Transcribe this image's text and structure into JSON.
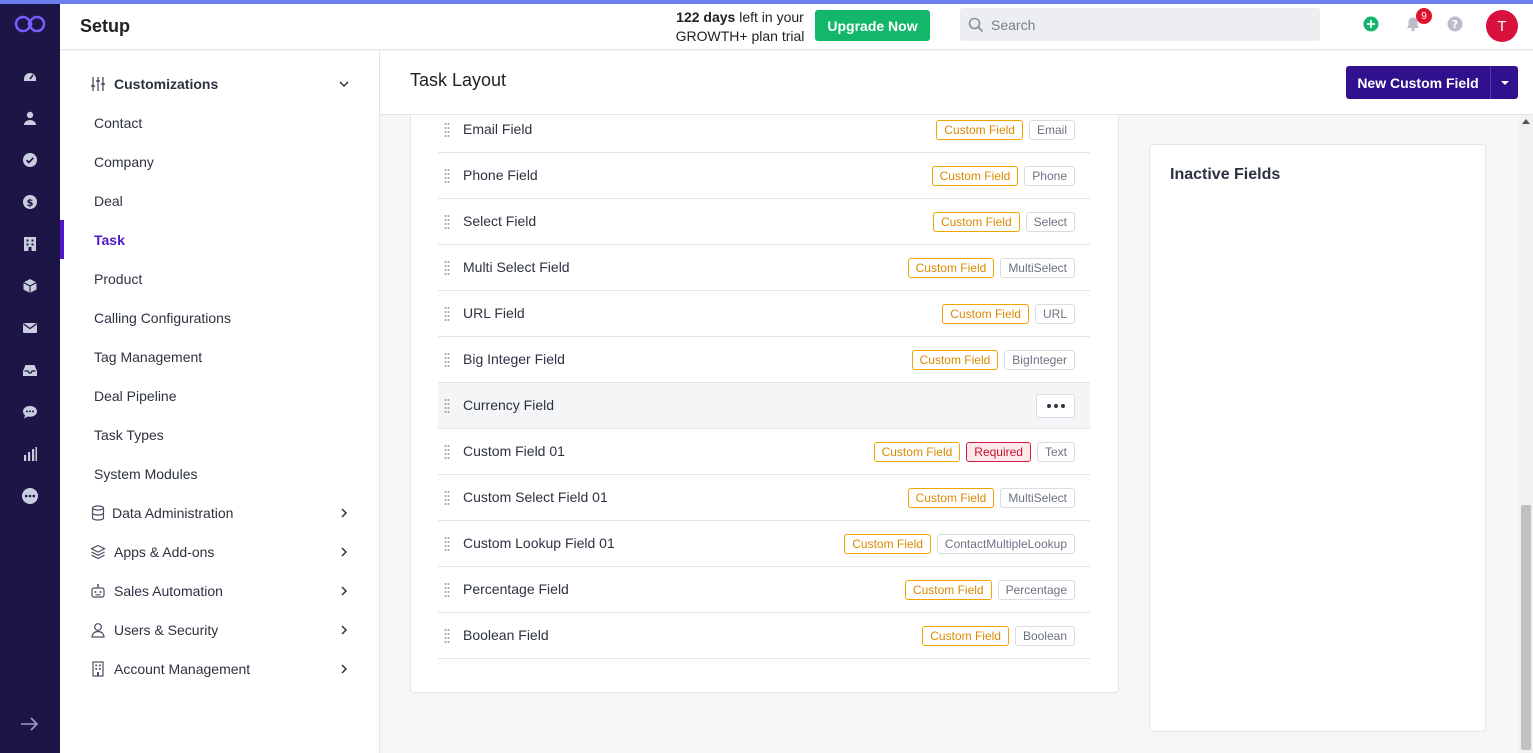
{
  "app": {
    "title": "Setup",
    "trial_days": "122 days",
    "trial_rest": " left in your GROWTH+ plan trial",
    "upgrade_label": "Upgrade Now",
    "search_placeholder": "Search",
    "notification_count": "9",
    "avatar_initial": "T"
  },
  "rail": {
    "icons": [
      "dashboard-icon",
      "contacts-icon",
      "tasks-icon",
      "deals-icon",
      "companies-icon",
      "products-icon",
      "email-icon",
      "inbox-icon",
      "chat-icon",
      "reports-icon",
      "more-icon"
    ]
  },
  "sidebar": {
    "customizations_label": "Customizations",
    "sub_items": [
      {
        "label": "Contact"
      },
      {
        "label": "Company"
      },
      {
        "label": "Deal"
      },
      {
        "label": "Task",
        "active": true
      },
      {
        "label": "Product"
      },
      {
        "label": "Calling Configurations"
      },
      {
        "label": "Tag Management"
      },
      {
        "label": "Deal Pipeline"
      },
      {
        "label": "Task Types"
      },
      {
        "label": "System Modules"
      }
    ],
    "sections": [
      {
        "label": "Data Administration",
        "icon": "database-icon"
      },
      {
        "label": "Apps & Add-ons",
        "icon": "layers-icon"
      },
      {
        "label": "Sales Automation",
        "icon": "robot-icon"
      },
      {
        "label": "Users & Security",
        "icon": "user-icon"
      },
      {
        "label": "Account Management",
        "icon": "building-icon"
      }
    ]
  },
  "page": {
    "title": "Task Layout",
    "new_button_label": "New Custom Field",
    "inactive_title": "Inactive Fields"
  },
  "fields": [
    {
      "name": "Email Field",
      "custom": "Custom Field",
      "type": "Email"
    },
    {
      "name": "Phone Field",
      "custom": "Custom Field",
      "type": "Phone"
    },
    {
      "name": "Select Field",
      "custom": "Custom Field",
      "type": "Select"
    },
    {
      "name": "Multi Select Field",
      "custom": "Custom Field",
      "type": "MultiSelect"
    },
    {
      "name": "URL Field",
      "custom": "Custom Field",
      "type": "URL"
    },
    {
      "name": "Big Integer Field",
      "custom": "Custom Field",
      "type": "BigInteger"
    },
    {
      "name": "Currency Field",
      "hovered": true
    },
    {
      "name": "Custom Field 01",
      "custom": "Custom Field",
      "required": "Required",
      "type": "Text"
    },
    {
      "name": "Custom Select Field 01",
      "custom": "Custom Field",
      "type": "MultiSelect"
    },
    {
      "name": "Custom Lookup Field 01",
      "custom": "Custom Field",
      "type": "ContactMultipleLookup"
    },
    {
      "name": "Percentage Field",
      "custom": "Custom Field",
      "type": "Percentage"
    },
    {
      "name": "Boolean Field",
      "custom": "Custom Field",
      "type": "Boolean"
    }
  ],
  "colors": {
    "rail": "#1d1545",
    "accent": "#4f18c5",
    "primary_button": "#30108d",
    "upgrade": "#12b76a",
    "custom_tag": "#f0a400",
    "required_tag": "#d61f3b"
  }
}
